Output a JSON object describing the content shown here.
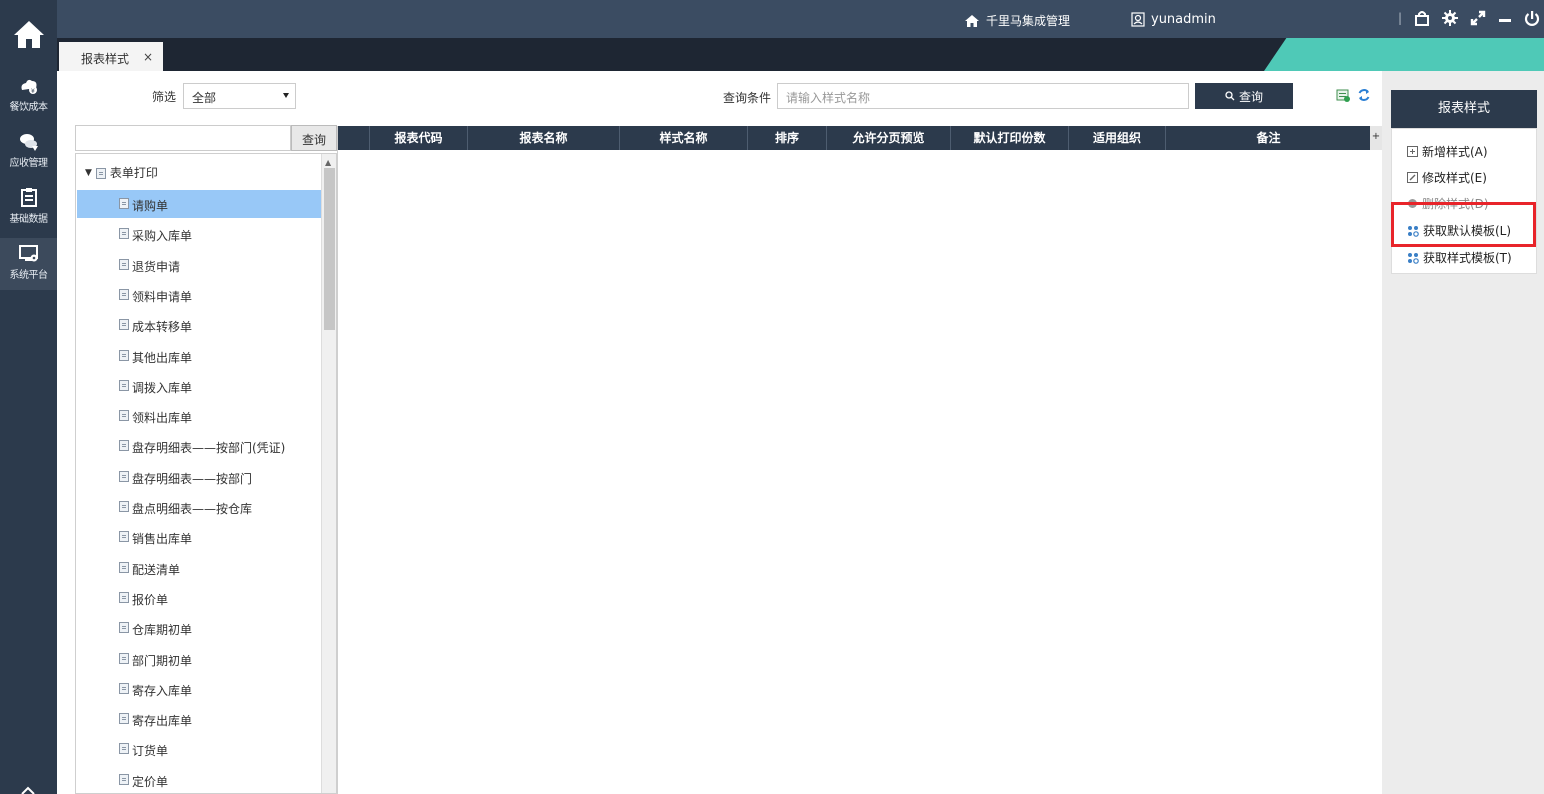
{
  "sidebar": {
    "items": [
      {
        "label": "餐饮成本",
        "icon": "chef-hat-icon"
      },
      {
        "label": "应收管理",
        "icon": "coins-icon"
      },
      {
        "label": "基础数据",
        "icon": "clipboard-icon"
      },
      {
        "label": "系统平台",
        "icon": "monitor-gear-icon"
      }
    ]
  },
  "topbar": {
    "brand": "千里马集成管理",
    "user": "yunadmin"
  },
  "tabs": [
    {
      "label": "报表样式",
      "close": "×"
    }
  ],
  "filter": {
    "label": "筛选",
    "value": "全部"
  },
  "query": {
    "label": "查询条件",
    "placeholder": "请输入样式名称",
    "button": "查询"
  },
  "tree": {
    "search_button": "查询",
    "root": "表单打印",
    "items": [
      "请购单",
      "采购入库单",
      "退货申请",
      "领料申请单",
      "成本转移单",
      "其他出库单",
      "调拨入库单",
      "领料出库单",
      "盘存明细表——按部门(凭证)",
      "盘存明细表——按部门",
      "盘点明细表——按仓库",
      "销售出库单",
      "配送清单",
      "报价单",
      "仓库期初单",
      "部门期初单",
      "寄存入库单",
      "寄存出库单",
      "订货单",
      "定价单"
    ],
    "selected": "请购单"
  },
  "grid": {
    "columns": [
      "报表代码",
      "报表名称",
      "样式名称",
      "排序",
      "允许分页预览",
      "默认打印份数",
      "适用组织",
      "备注"
    ],
    "plus": "+"
  },
  "rightpanel": {
    "title": "报表样式",
    "actions": [
      "新增样式(A)",
      "修改样式(E)",
      "删除样式(D)",
      "获取默认模板(L)",
      "获取样式模板(T)"
    ]
  },
  "colors": {
    "dark": "#2c3a4c",
    "topbar": "#3b4c62",
    "selected": "#98c8f7",
    "highlight": "#e8242a",
    "teal": "#4fc9b7"
  }
}
